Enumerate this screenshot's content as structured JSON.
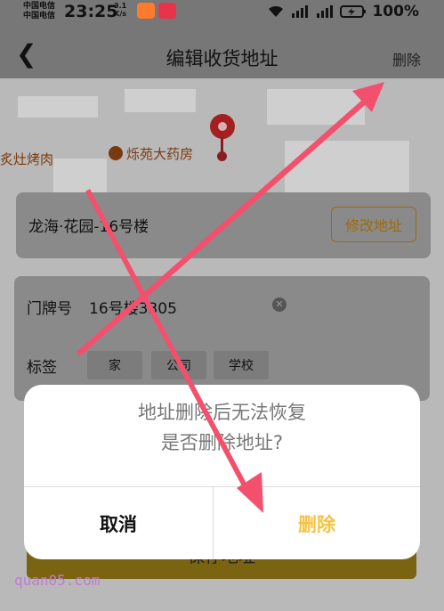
{
  "status_bar": {
    "carrier_1": "中国电信",
    "carrier_2": "中国电信",
    "time": "23:25",
    "speed_value": "3.1",
    "speed_unit": "K/s",
    "battery": "100%"
  },
  "header": {
    "title": "编辑收货地址",
    "delete_label": "删除"
  },
  "map": {
    "poi_1": "炙灶烤肉",
    "poi_2": "烁苑大药房"
  },
  "address_card": {
    "address": "龙海·花园-16号楼",
    "edit_label": "修改地址"
  },
  "form": {
    "house_label": "门牌号",
    "house_value": "16号楼3305",
    "tag_label": "标签",
    "tags": [
      "家",
      "公司",
      "学校"
    ]
  },
  "save_button": {
    "label": "保存地址"
  },
  "dialog": {
    "message_line1": "地址删除后无法恢复",
    "message_line2": "是否删除地址?",
    "cancel_label": "取消",
    "confirm_label": "删除"
  },
  "watermark": "quan05.com",
  "colors": {
    "accent_yellow": "#f5c340",
    "annotation_arrow": "#f2506c"
  }
}
